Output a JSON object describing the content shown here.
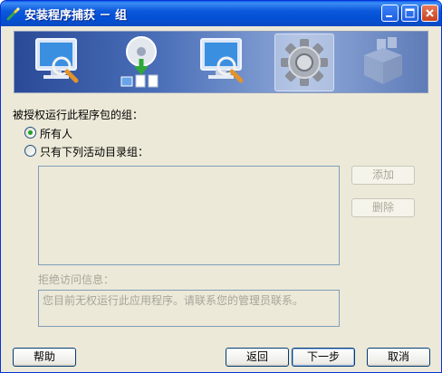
{
  "window": {
    "title": "安装程序捕获 － 组"
  },
  "steps": [
    {
      "name": "monitor-magnifier-icon",
      "active": false
    },
    {
      "name": "disc-download-icon",
      "active": false
    },
    {
      "name": "monitor-magnifier-icon",
      "active": false
    },
    {
      "name": "gear-icon",
      "active": true
    },
    {
      "name": "package-box-icon",
      "active": false
    }
  ],
  "form": {
    "section_label": "被授权运行此程序包的组：",
    "option_everyone": "所有人",
    "option_ad_groups": "只有下列活动目录组：",
    "selected_option": "option_everyone",
    "add_button": "添加",
    "delete_button": "删除",
    "deny_label": "拒绝访问信息：",
    "deny_message": "您目前无权运行此应用程序。请联系您的管理员联系。"
  },
  "footer": {
    "help": "帮助",
    "back": "返回",
    "next": "下一步",
    "cancel": "取消"
  },
  "colors": {
    "titlebar": "#0a58dc",
    "window_bg": "#ece9d8",
    "radio_dot": "#21a121"
  }
}
